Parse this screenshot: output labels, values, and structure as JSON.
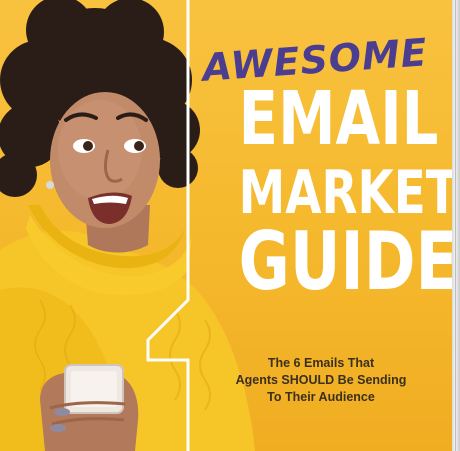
{
  "cover": {
    "kicker": "AWESOME",
    "title_lines": [
      "EMAIL",
      "MARKETING",
      "GUIDE"
    ],
    "subtitle_lines": [
      "The 6 Emails That",
      "Agents SHOULD Be Sending",
      "To Their Audience"
    ]
  },
  "colors": {
    "background": "#f5b82c",
    "kicker": "#4b3d8f",
    "title": "#ffffff",
    "subtitle": "#3b2f1d",
    "sweater": "#f4c21f"
  }
}
